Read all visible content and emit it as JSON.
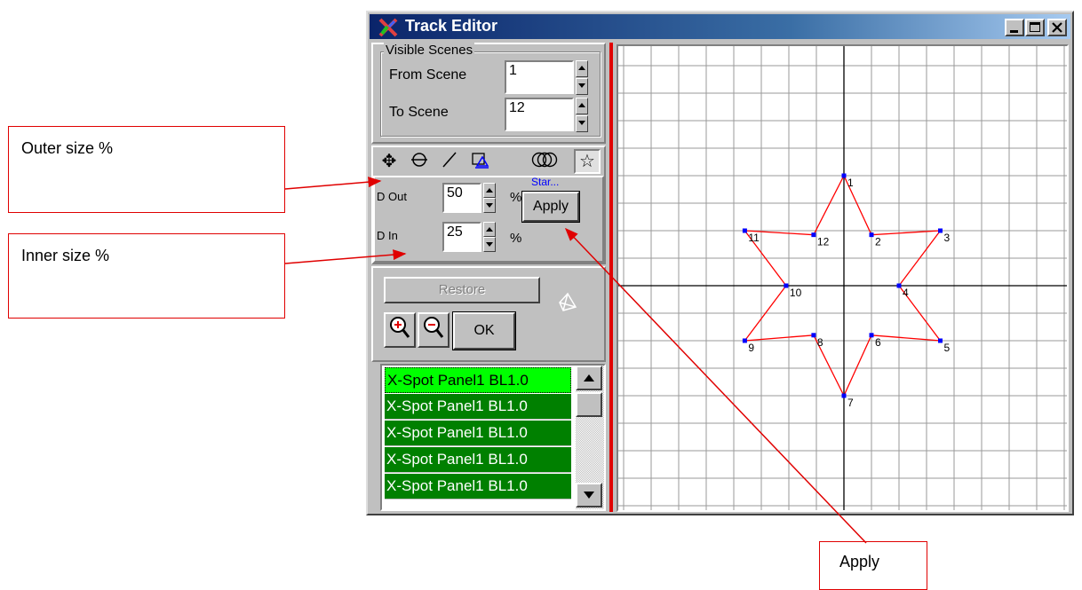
{
  "window": {
    "title": "Track Editor",
    "accent_color": "#0a246a",
    "buttons": [
      "minimize-icon",
      "maximize-icon",
      "close-icon"
    ]
  },
  "visible_scenes": {
    "legend": "Visible Scenes",
    "from_label": "From Scene",
    "from_value": "1",
    "to_label": "To Scene",
    "to_value": "12"
  },
  "shape_tools": {
    "icons": [
      "move-icon",
      "circle-path-icon",
      "line-icon",
      "polygon-icon",
      "rings-icon",
      "star-icon"
    ],
    "selected": "star-icon",
    "mode_label": "Star...",
    "dout_label": "D Out",
    "dout_value": "50",
    "din_label": "D In",
    "din_value": "25",
    "percent": "%",
    "apply_label": "Apply"
  },
  "controls": {
    "restore_label": "Restore",
    "ok_label": "OK"
  },
  "fixture_list": {
    "items": [
      "X-Spot Panel1 BL1.0",
      "X-Spot Panel1 BL1.0",
      "X-Spot Panel1 BL1.0",
      "X-Spot Panel1 BL1.0",
      "X-Spot Panel1 BL1.0"
    ],
    "selected_index": 0
  },
  "track": {
    "points": [
      {
        "label": "1",
        "x": 0,
        "y": 4
      },
      {
        "label": "2",
        "x": 1,
        "y": 1.85
      },
      {
        "label": "3",
        "x": 3.5,
        "y": 2
      },
      {
        "label": "4",
        "x": 2,
        "y": 0
      },
      {
        "label": "5",
        "x": 3.5,
        "y": -2
      },
      {
        "label": "6",
        "x": 1,
        "y": -1.8
      },
      {
        "label": "7",
        "x": 0,
        "y": -4
      },
      {
        "label": "8",
        "x": -1.1,
        "y": -1.8
      },
      {
        "label": "9",
        "x": -3.6,
        "y": -2
      },
      {
        "label": "10",
        "x": -2.1,
        "y": 0
      },
      {
        "label": "11",
        "x": -3.6,
        "y": 2
      },
      {
        "label": "12",
        "x": -1.1,
        "y": 1.85
      }
    ],
    "line_color": "#ff0000",
    "point_color": "#0000ff"
  },
  "annotations": {
    "outer": "Outer size %",
    "inner": "Inner size %",
    "apply": "Apply",
    "color": "#e00000"
  }
}
